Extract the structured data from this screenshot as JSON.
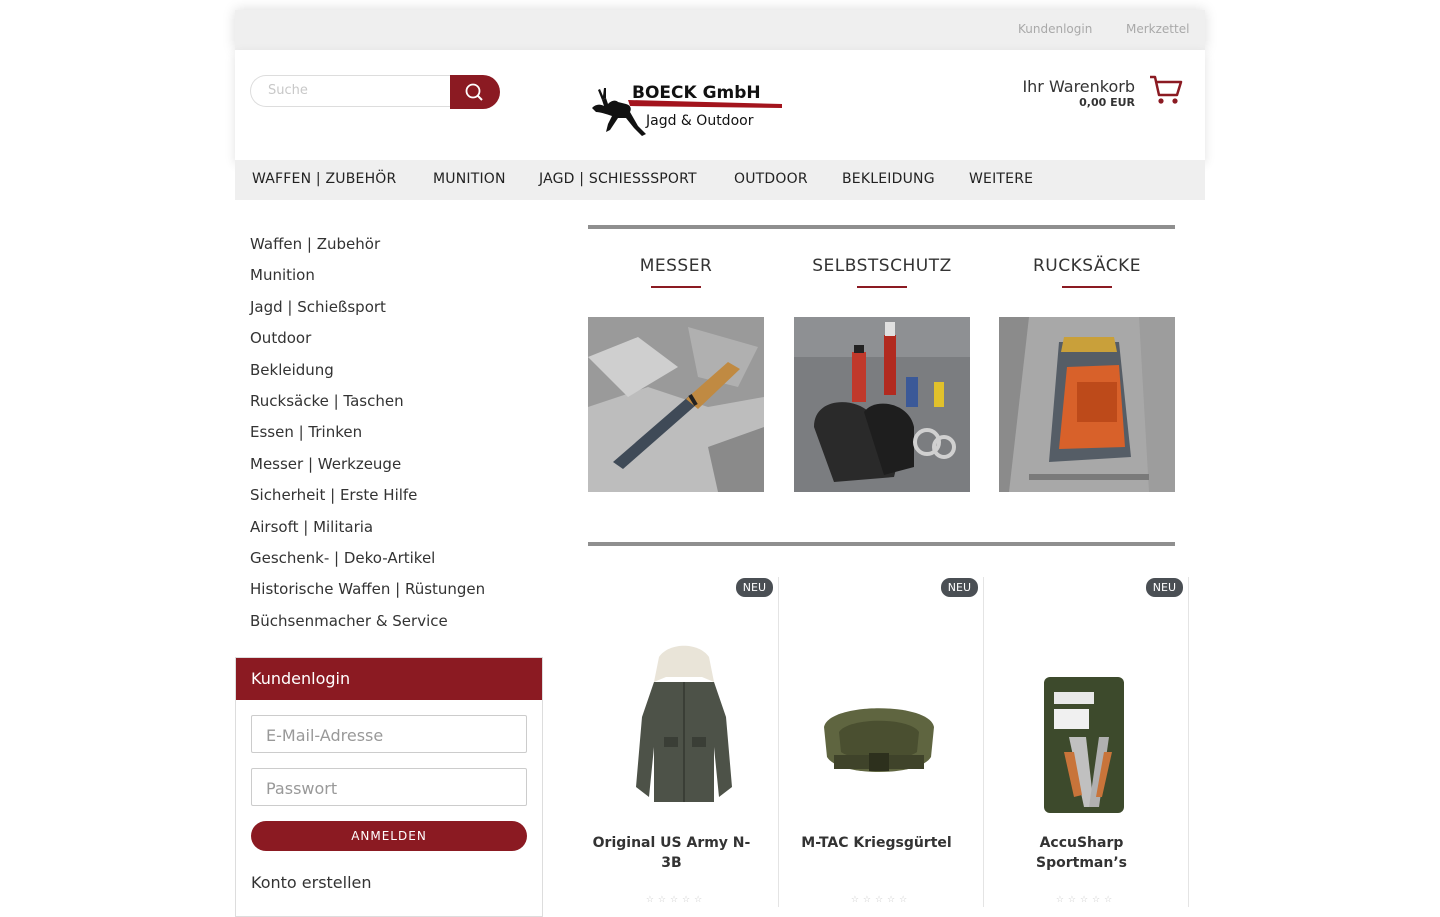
{
  "topbar": {
    "login_link": "Kundenlogin",
    "wishlist_link": "Merkzettel"
  },
  "header": {
    "search_placeholder": "Suche",
    "logo_name": "BOECK GmbH",
    "logo_tagline": "Jagd & Outdoor",
    "cart_title": "Ihr Warenkorb",
    "cart_sum": "0,00 EUR",
    "brand_color": "#8b1a22"
  },
  "nav": [
    "WAFFEN | ZUBEHÖR",
    "MUNITION",
    "JAGD | SCHIESSSPORT",
    "OUTDOOR",
    "BEKLEIDUNG",
    "WEITERE"
  ],
  "sidebar": {
    "categories": [
      "Waffen | Zubehör",
      "Munition",
      "Jagd | Schießsport",
      "Outdoor",
      "Bekleidung",
      "Rucksäcke | Taschen",
      "Essen | Trinken",
      "Messer | Werkzeuge",
      "Sicherheit | Erste Hilfe",
      "Airsoft | Militaria",
      "Geschenk- | Deko-Artikel",
      "Historische Waffen | Rüstungen",
      "Büchsenmacher & Service"
    ]
  },
  "login": {
    "title": "Kundenlogin",
    "email_placeholder": "E-Mail-Adresse",
    "password_placeholder": "Passwort",
    "submit_label": "ANMELDEN",
    "create_account": "Konto erstellen"
  },
  "featured": [
    {
      "title": "MESSER",
      "image": "knife-on-rock"
    },
    {
      "title": "SELBSTSCHUTZ",
      "image": "pepper-spray-gloves-handcuffs"
    },
    {
      "title": "RUCKSÄCKE",
      "image": "orange-backpack-in-grass"
    }
  ],
  "products": [
    {
      "badge": "NEU",
      "name": "Original US Army N-3B",
      "image": "parka-jacket"
    },
    {
      "badge": "NEU",
      "name": "M-TAC Kriegsgürtel",
      "image": "green-belt"
    },
    {
      "badge": "NEU",
      "name": "AccuSharp Sportman’s",
      "image": "multi-tool-package"
    }
  ],
  "rating_stars": "☆☆☆☆☆"
}
